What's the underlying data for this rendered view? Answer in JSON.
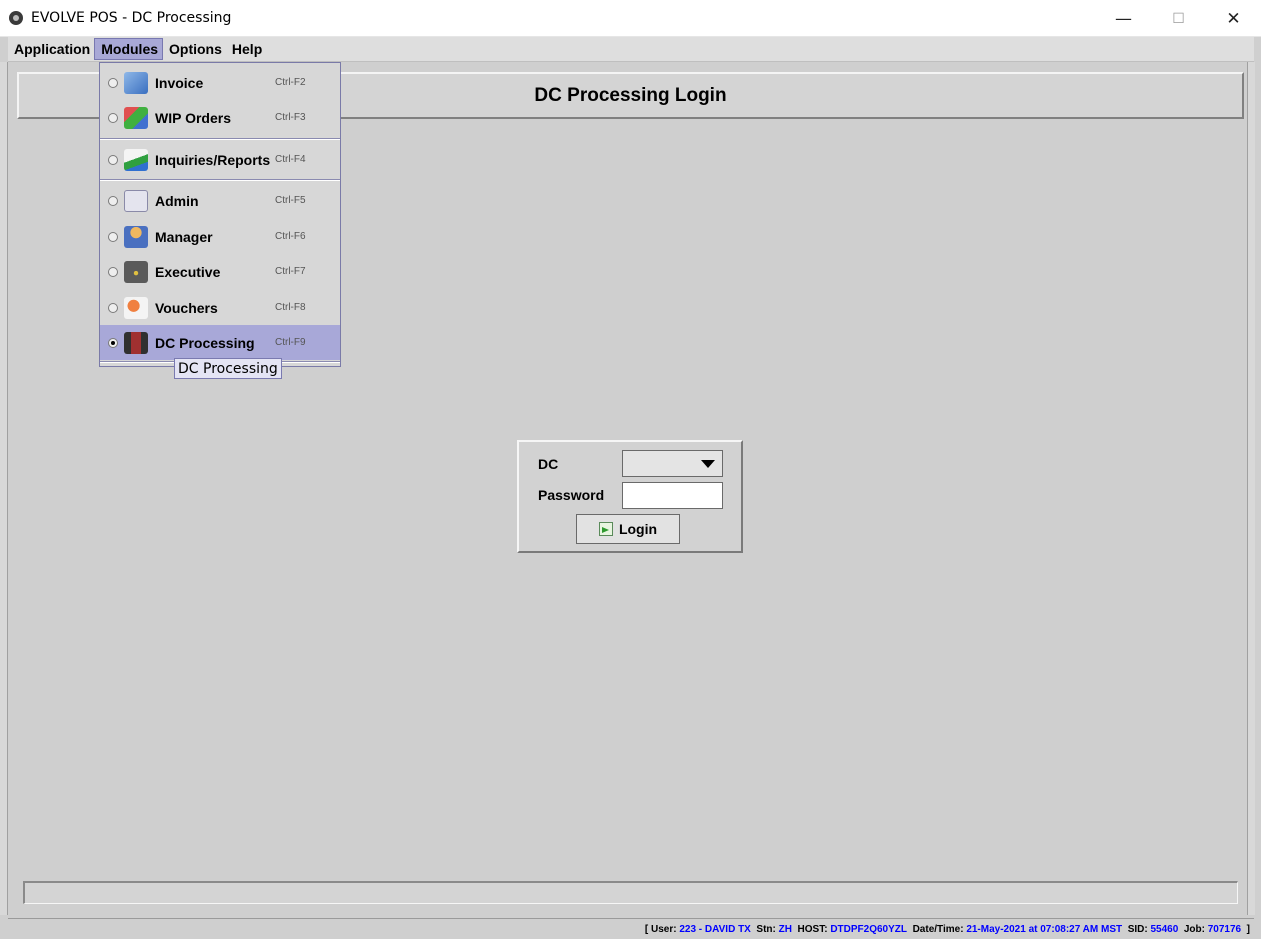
{
  "window": {
    "title": "EVOLVE POS - DC Processing",
    "minimize": "—",
    "maximize": "☐",
    "close": "✕"
  },
  "menubar": {
    "items": [
      {
        "label": "Application",
        "active": false
      },
      {
        "label": "Modules",
        "active": true
      },
      {
        "label": "Options",
        "active": false
      },
      {
        "label": "Help",
        "active": false
      }
    ]
  },
  "header": {
    "title": "DC Processing Login"
  },
  "modules_menu": {
    "items": [
      {
        "label": "Invoice",
        "accel": "Ctrl-F2",
        "icon": "invoice-icon",
        "color": "#5b8fd6",
        "selected": false
      },
      {
        "label": "WIP Orders",
        "accel": "Ctrl-F3",
        "icon": "wip-orders-icon",
        "color": "#d65050",
        "selected": false
      },
      {
        "label": "Inquiries/Reports",
        "accel": "Ctrl-F4",
        "icon": "chart-icon",
        "color": "#3aa03a",
        "selected": false
      },
      {
        "label": "Admin",
        "accel": "Ctrl-F5",
        "icon": "cabinet-icon",
        "color": "#c8c8dc",
        "selected": false
      },
      {
        "label": "Manager",
        "accel": "Ctrl-F6",
        "icon": "person-icon",
        "color": "#e0a040",
        "selected": false
      },
      {
        "label": "Executive",
        "accel": "Ctrl-F7",
        "icon": "briefcase-icon",
        "color": "#505050",
        "selected": false
      },
      {
        "label": "Vouchers",
        "accel": "Ctrl-F8",
        "icon": "voucher-icon",
        "color": "#e07030",
        "selected": false
      },
      {
        "label": "DC Processing",
        "accel": "Ctrl-F9",
        "icon": "forklift-icon",
        "color": "#702020",
        "selected": true
      }
    ],
    "tooltip": "DC Processing"
  },
  "login": {
    "dc_label": "DC",
    "dc_value": "",
    "password_label": "Password",
    "password_value": "",
    "button_label": "Login"
  },
  "status": {
    "user_label": "User:",
    "user": "223 - DAVID TX",
    "stn_label": "Stn:",
    "stn": "ZH",
    "host_label": "HOST:",
    "host": "DTDPF2Q60YZL",
    "datetime_label": "Date/Time:",
    "datetime": "21-May-2021 at 07:08:27 AM MST",
    "sid_label": "SID:",
    "sid": "55460",
    "job_label": "Job:",
    "job": "707176"
  }
}
